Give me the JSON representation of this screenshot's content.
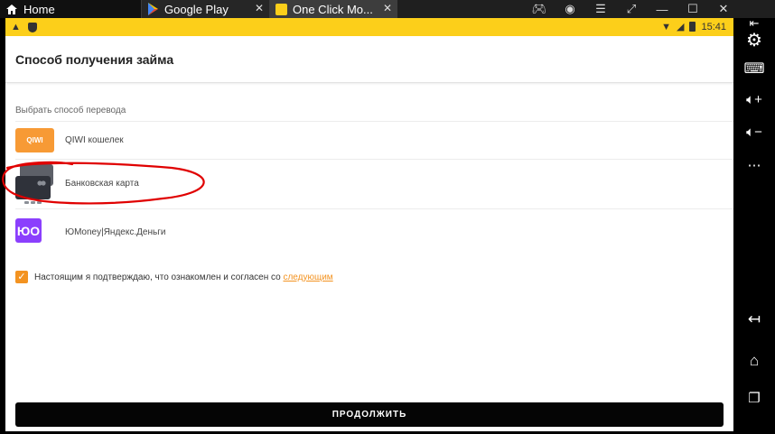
{
  "emulator": {
    "tabs": [
      {
        "label": "Home",
        "icon": "home-icon"
      },
      {
        "label": "Google Play",
        "icon": "google-play-icon"
      },
      {
        "label": "One Click Mo...",
        "icon": "app-icon"
      }
    ],
    "toolbar_icons": [
      "gamepad-icon",
      "account-icon",
      "menu-icon",
      "resize-icon",
      "minimize-icon",
      "maximize-icon",
      "close-icon"
    ],
    "sidebar_icons": [
      "expand-icon",
      "settings-icon",
      "keyboard-icon",
      "volume-up-icon",
      "volume-down-icon",
      "more-icon",
      "back-icon",
      "home-icon",
      "recent-apps-icon"
    ]
  },
  "statusbar": {
    "time": "15:41",
    "color": "#fccf1a"
  },
  "page": {
    "title": "Способ получения займа",
    "section_label": "Выбрать способ перевода",
    "methods": [
      {
        "name": "QIWI кошелек",
        "icon": "qiwi-icon",
        "color": "#f79a35"
      },
      {
        "name": "Банковская карта",
        "icon": "bank-card-icon",
        "color": "#2f323a"
      },
      {
        "name": "ЮMoney|Яндекс.Деньги",
        "icon": "yoomoney-icon",
        "color": "#8b3ffd"
      }
    ],
    "consent": {
      "checked": true,
      "text": "Настоящим я подтверждаю, что ознакомлен и согласен со",
      "link": "следующим"
    },
    "continue_label": "ПРОДОЛЖИТЬ",
    "qiwi_logo": "QIWI",
    "yoo_logo": "ЮO"
  },
  "annotation_color": "#e00000"
}
